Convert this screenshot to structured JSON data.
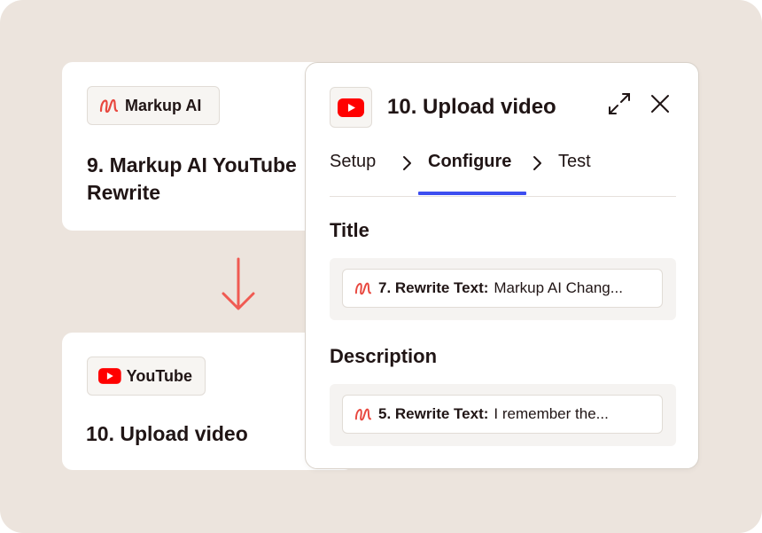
{
  "steps": [
    {
      "app": {
        "name": "Markup AI",
        "icon": "markup-ai-logo-icon"
      },
      "title": "9. Markup AI YouTube Rewrite"
    },
    {
      "app": {
        "name": "YouTube",
        "icon": "youtube-logo-icon"
      },
      "title": "10. Upload video"
    }
  ],
  "panel": {
    "app_icon": "youtube-logo-icon",
    "title": "10. Upload video",
    "tabs": [
      {
        "label": "Setup",
        "active": false
      },
      {
        "label": "Configure",
        "active": true
      },
      {
        "label": "Test",
        "active": false
      }
    ],
    "fields": [
      {
        "label": "Title",
        "value_icon": "markup-ai-logo-icon",
        "value_step": "7. Rewrite Text:",
        "value_text": "Markup AI Chang..."
      },
      {
        "label": "Description",
        "value_icon": "markup-ai-logo-icon",
        "value_step": "5. Rewrite Text:",
        "value_text": "I remember the..."
      }
    ]
  },
  "colors": {
    "background": "#ece4dd",
    "accent": "#3d4ef0",
    "youtube_red": "#ff0000",
    "markup_ai_red": "#e8483f",
    "arrow": "#f05a52"
  }
}
